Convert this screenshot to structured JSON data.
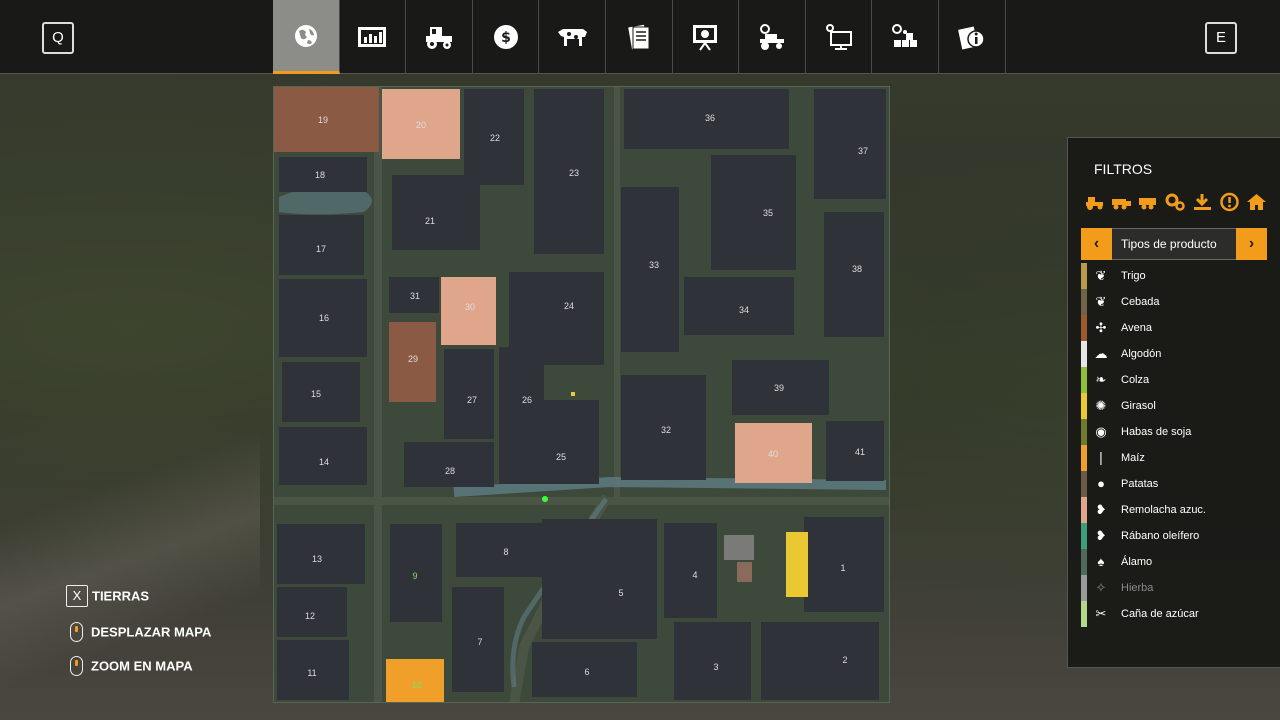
{
  "topbar": {
    "left_key": "Q",
    "right_key": "E",
    "tabs": [
      {
        "icon": "globe-icon",
        "active": true
      },
      {
        "icon": "stats-icon",
        "active": false
      },
      {
        "icon": "tractor-icon",
        "active": false
      },
      {
        "icon": "money-icon",
        "active": false
      },
      {
        "icon": "cow-icon",
        "active": false
      },
      {
        "icon": "contracts-icon",
        "active": false
      },
      {
        "icon": "presentation-icon",
        "active": false
      },
      {
        "icon": "vehicle-settings-icon",
        "active": false
      },
      {
        "icon": "computer-icon",
        "active": false
      },
      {
        "icon": "production-icon",
        "active": false
      },
      {
        "icon": "info-icon",
        "active": false
      }
    ],
    "accent_color": "#f39c1b"
  },
  "map": {
    "fields": [
      "19",
      "20",
      "22",
      "23",
      "36",
      "37",
      "18",
      "21",
      "35",
      "17",
      "33",
      "38",
      "31",
      "30",
      "24",
      "34",
      "16",
      "29",
      "39",
      "15",
      "27",
      "26",
      "32",
      "40",
      "41",
      "14",
      "28",
      "25",
      "13",
      "8",
      "4",
      "1",
      "9",
      "5",
      "12",
      "7",
      "2",
      "11",
      "10",
      "6",
      "3"
    ]
  },
  "filters": {
    "title": "FILTROS",
    "selector_label": "Tipos de producto",
    "selector_prev": "‹",
    "selector_next": "›",
    "products": [
      {
        "label": "Trigo",
        "color": "#b89b4a",
        "icon": "wheat-icon"
      },
      {
        "label": "Cebada",
        "color": "#6f6447",
        "icon": "barley-icon"
      },
      {
        "label": "Avena",
        "color": "#9b5a2c",
        "icon": "oat-icon"
      },
      {
        "label": "Algodón",
        "color": "#e6e6e6",
        "icon": "cotton-icon"
      },
      {
        "label": "Colza",
        "color": "#8fbf3a",
        "icon": "canola-icon"
      },
      {
        "label": "Girasol",
        "color": "#e9c832",
        "icon": "sunflower-icon"
      },
      {
        "label": "Habas de soja",
        "color": "#6e7a2c",
        "icon": "soybean-icon"
      },
      {
        "label": "Maíz",
        "color": "#f0a02a",
        "icon": "maize-icon"
      },
      {
        "label": "Patatas",
        "color": "#6b5a48",
        "icon": "potato-icon"
      },
      {
        "label": "Remolacha azuc.",
        "color": "#e0a68c",
        "icon": "sugarbeet-icon"
      },
      {
        "label": "Rábano oleífero",
        "color": "#3aa07a",
        "icon": "radish-icon"
      },
      {
        "label": "Álamo",
        "color": "#4f6a5a",
        "icon": "poplar-icon"
      },
      {
        "label": "Hierba",
        "color": "#9a9a98",
        "icon": "grass-icon",
        "dim": true
      },
      {
        "label": "Caña de azúcar",
        "color": "#b3d88a",
        "icon": "sugarcane-icon"
      }
    ]
  },
  "help": {
    "lands_key": "X",
    "lands_label": "TIERRAS",
    "pan_label": "DESPLAZAR MAPA",
    "zoom_label": "ZOOM EN MAPA"
  }
}
